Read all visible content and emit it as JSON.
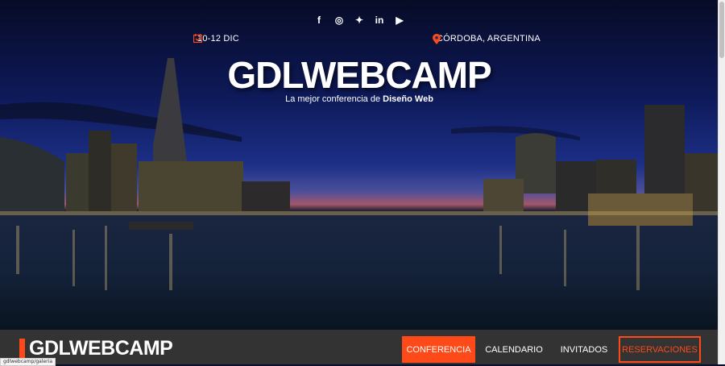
{
  "hero": {
    "social": [
      {
        "name": "facebook-icon",
        "glyph": "f"
      },
      {
        "name": "instagram-icon",
        "glyph": "◎"
      },
      {
        "name": "twitter-icon",
        "glyph": "✦"
      },
      {
        "name": "linkedin-icon",
        "glyph": "in"
      },
      {
        "name": "youtube-icon",
        "glyph": "▶"
      }
    ],
    "date": "10-12 DIC",
    "location": "CÓRDOBA, ARGENTINA",
    "title": "GDLWEBCAMP",
    "subtitle_prefix": "La mejor conferencia de ",
    "subtitle_bold": "Diseño Web"
  },
  "navbar": {
    "logo": "GDLWEBCAMP",
    "items": [
      {
        "label": "CONFERENCIA",
        "state": "active"
      },
      {
        "label": "CALENDARIO",
        "state": "normal"
      },
      {
        "label": "INVITADOS",
        "state": "normal"
      },
      {
        "label": "RESERVACIONES",
        "state": "outline"
      }
    ]
  },
  "status_url": "gdlwebcamp/galeria",
  "colors": {
    "accent": "#fe4918",
    "navbar": "#333333"
  }
}
